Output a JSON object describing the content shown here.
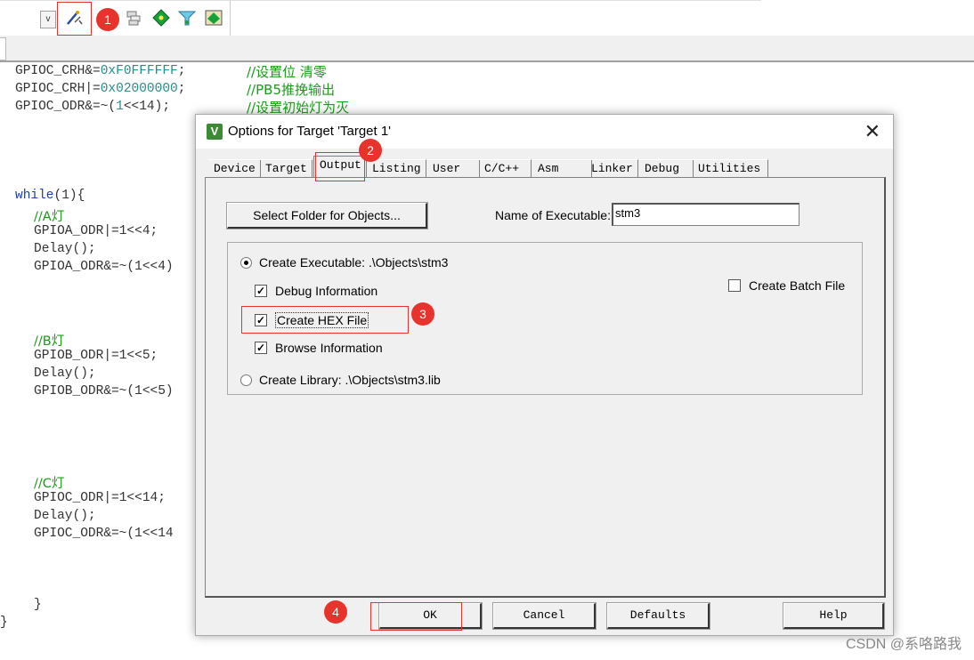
{
  "toolbar": {
    "dropdown_glyph": "v",
    "icons": [
      "target-options-wand-icon",
      "blue-config-icon",
      "stack-layers-icon",
      "green-diamond-icon",
      "funnel-icon",
      "component-manager-icon"
    ]
  },
  "code": {
    "lines": [
      {
        "text": "GPIOC_CRH&=",
        "num": "0xF0FFFFFF",
        "tail": ";",
        "comment": "//设置位 清零"
      },
      {
        "text": "GPIOC_CRH|=",
        "num": "0x02000000",
        "tail": ";",
        "comment": "//PB5推挽输出"
      },
      {
        "text": "GPIOC_ODR&=~(",
        "num": "1",
        "tail": "<<14);",
        "comment": "//设置初始灯为灭"
      }
    ],
    "while_kw": "while",
    "while_tail": "(1){",
    "while_num": "1",
    "block_a": {
      "comment": "//A灯",
      "l1": "GPIOA_ODR|=1<<4;",
      "l2": "Delay();",
      "l3": "GPIOA_ODR&=~(1<<4)"
    },
    "block_b": {
      "comment": "//B灯",
      "l1": "GPIOB_ODR|=1<<5;",
      "l2": "Delay();",
      "l3": "GPIOB_ODR&=~(1<<5)"
    },
    "block_c": {
      "comment": "//C灯",
      "l1": "GPIOC_ODR|=1<<14;",
      "l2": "Delay();",
      "l3": "GPIOC_ODR&=~(1<<14"
    },
    "close_inner": "}",
    "close_outer": "}"
  },
  "dialog": {
    "title": "Options for Target 'Target 1'",
    "close_glyph": "✕",
    "app_icon_letter": "V",
    "tabs": [
      "Device",
      "Target",
      "Output",
      "Listing",
      "User",
      "C/C++",
      "Asm",
      "Linker",
      "Debug",
      "Utilities"
    ],
    "active_tab": "Output",
    "select_folder_label": "Select Folder for Objects...",
    "name_exe_label": "Name of Executable:",
    "name_exe_value": "stm3",
    "create_executable_label": "Create Executable:  .\\Objects\\stm3",
    "debug_info_label": "Debug Information",
    "create_hex_label": "Create HEX File",
    "browse_info_label": "Browse Information",
    "create_library_label": "Create Library:  .\\Objects\\stm3.lib",
    "create_batch_label": "Create Batch File",
    "ok_label": "OK",
    "cancel_label": "Cancel",
    "defaults_label": "Defaults",
    "help_label": "Help"
  },
  "callouts": [
    "1",
    "2",
    "3",
    "4"
  ],
  "watermark": "CSDN @系咯路我",
  "colors": {
    "callout": "#e8322c",
    "comment": "#1a9b1a",
    "number": "#2a8c8c",
    "keyword": "#1f3fa8"
  }
}
